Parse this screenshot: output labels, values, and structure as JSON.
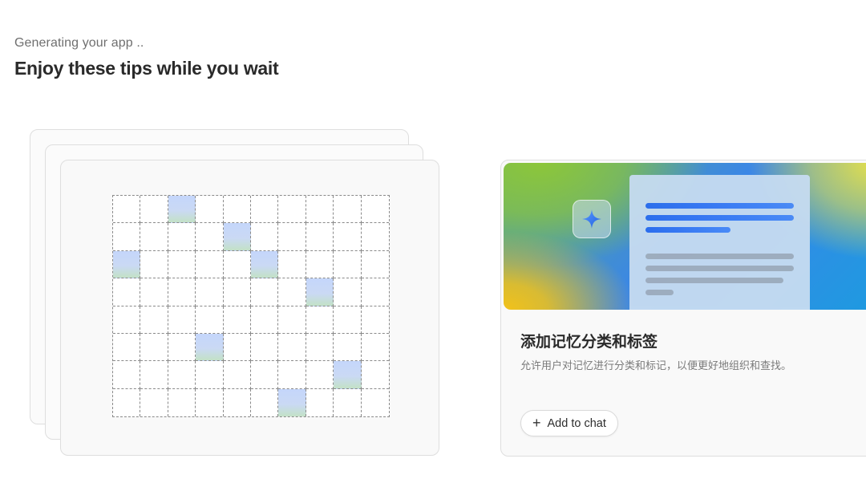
{
  "header": {
    "status": "Generating your app ..",
    "headline": "Enjoy these tips while you wait"
  },
  "grid": {
    "rows": 8,
    "cols": 10,
    "highlighted": [
      [
        0,
        2
      ],
      [
        1,
        4
      ],
      [
        2,
        0
      ],
      [
        2,
        5
      ],
      [
        3,
        7
      ],
      [
        5,
        3
      ],
      [
        6,
        8
      ],
      [
        7,
        6
      ]
    ]
  },
  "tip": {
    "icon": "sparkle-icon",
    "title": "添加记忆分类和标签",
    "description": "允许用户对记忆进行分类和标记，以便更好地组织和查找。",
    "add_button_icon": "plus-icon",
    "add_button_label": "Add to chat"
  },
  "colors": {
    "grid_highlight": "#c4d6fb",
    "accent_blue": "#2a6cf0"
  }
}
